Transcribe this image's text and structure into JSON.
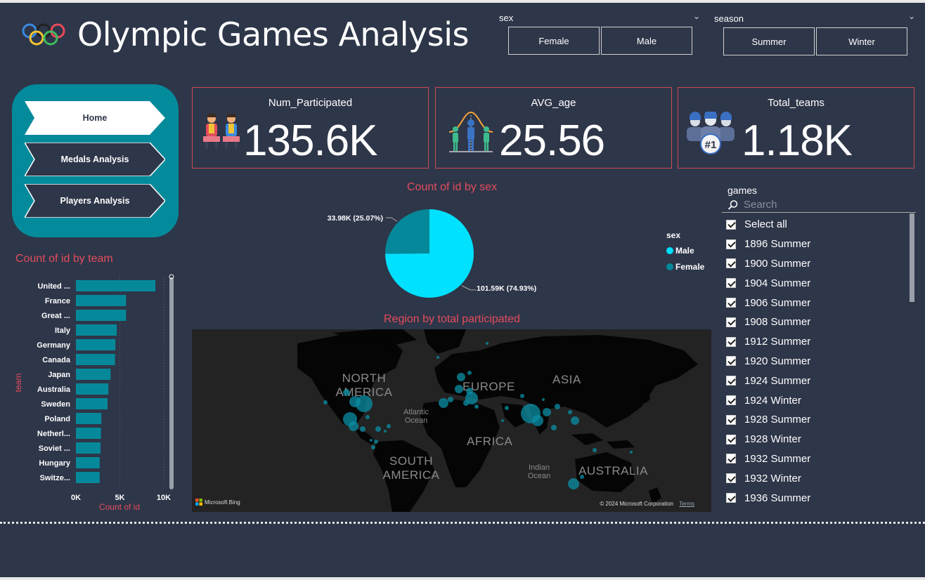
{
  "header": {
    "title": "Olympic Games Analysis",
    "logo_icon": "olympic-rings-icon"
  },
  "filters": {
    "sex": {
      "label": "sex",
      "options": [
        "Female",
        "Male"
      ]
    },
    "season": {
      "label": "season",
      "options": [
        "Summer",
        "Winter"
      ]
    }
  },
  "nav": {
    "items": [
      "Home",
      "Medals Analysis",
      "Players Analysis"
    ],
    "active": "Home"
  },
  "cards": [
    {
      "title": "Num_Participated",
      "value": "135.6K",
      "icon": "athletes-icon"
    },
    {
      "title": "AVG_age",
      "value": "25.56",
      "icon": "distribution-people-icon"
    },
    {
      "title": "Total_teams",
      "value": "1.18K",
      "icon": "team-number-one-icon"
    }
  ],
  "bar_title": "Count of id by team",
  "pie_title": "Count of id by sex",
  "map": {
    "title": "Region by total participated",
    "labels": {
      "north_america": "NORTH AMERICA",
      "europe": "EUROPE",
      "asia": "ASIA",
      "south_america": "SOUTH AMERICA",
      "africa": "AFRICA",
      "australia": "AUSTRALIA",
      "atlantic": "Atlantic Ocean",
      "indian": "Indian Ocean"
    },
    "brand": "Microsoft Bing",
    "copyright": "© 2024 Microsoft Corporation",
    "terms": "Terms"
  },
  "games_slicer": {
    "label": "games",
    "search_placeholder": "Search",
    "items": [
      "Select all",
      "1896 Summer",
      "1900 Summer",
      "1904 Summer",
      "1906 Summer",
      "1908 Summer",
      "1912 Summer",
      "1920 Summer",
      "1924 Summer",
      "1924 Winter",
      "1928 Summer",
      "1928 Winter",
      "1932 Summer",
      "1932 Winter",
      "1936 Summer"
    ]
  },
  "colors": {
    "accent": "#038b9c",
    "title_red": "#e34c5c",
    "male": "#00e0ff",
    "female": "#05899a",
    "bg": "#2e3649"
  },
  "chart_data": [
    {
      "type": "bar",
      "title": "Count of id by team",
      "xlabel": "Count of id",
      "ylabel": "team",
      "categories": [
        "United ...",
        "France",
        "Great ...",
        "Italy",
        "Germany",
        "Canada",
        "Japan",
        "Australia",
        "Sweden",
        "Poland",
        "Netherl...",
        "Soviet ...",
        "Hungary",
        "Switze..."
      ],
      "values": [
        9050,
        5700,
        5700,
        4650,
        4500,
        4450,
        3950,
        3700,
        3600,
        2900,
        2850,
        2800,
        2700,
        2700
      ],
      "xlim": [
        0,
        10000
      ],
      "xticks": [
        "0K",
        "5K",
        "10K"
      ]
    },
    {
      "type": "pie",
      "title": "Count of id by sex",
      "legend_title": "sex",
      "legend_position": "right",
      "slices": [
        {
          "name": "Male",
          "value": 101590,
          "label": "101.59K (74.93%)"
        },
        {
          "name": "Female",
          "value": 33980,
          "label": "33.98K (25.07%)"
        }
      ]
    }
  ]
}
